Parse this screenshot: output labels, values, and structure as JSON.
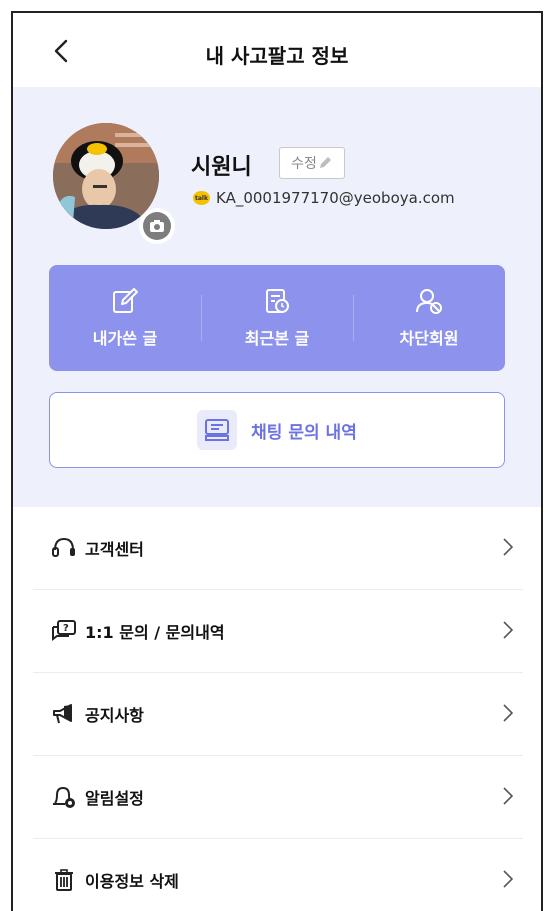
{
  "header": {
    "title": "내 사고팔고 정보"
  },
  "profile": {
    "name": "시원니",
    "edit_label": "수정",
    "email": "KA_0001977170@yeoboya.com",
    "login_badge": "talk"
  },
  "quick_actions": [
    {
      "label": "내가쓴 글",
      "icon": "edit-note-icon"
    },
    {
      "label": "최근본 글",
      "icon": "recent-doc-icon"
    },
    {
      "label": "차단회원",
      "icon": "block-user-icon"
    }
  ],
  "chat_history": {
    "label": "채팅 문의 내역",
    "icon": "chat-inbox-icon"
  },
  "menu": [
    {
      "label": "고객센터",
      "icon": "headset-icon"
    },
    {
      "label": "1:1 문의 / 문의내역",
      "icon": "question-chat-icon"
    },
    {
      "label": "공지사항",
      "icon": "megaphone-icon"
    },
    {
      "label": "알림설정",
      "icon": "bell-gear-icon"
    },
    {
      "label": "이용정보 삭제",
      "icon": "trash-icon"
    }
  ],
  "colors": {
    "accent": "#8d93ec",
    "panel_bg": "#eef0fb",
    "accent_text": "#6c72e0"
  }
}
